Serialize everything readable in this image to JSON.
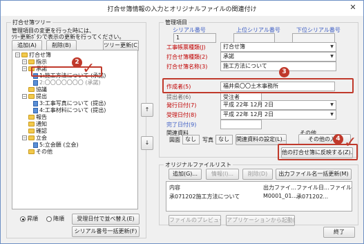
{
  "window": {
    "title": "打合せ簿情報の入力とオリジナルファイルの関連付け",
    "close": "✕"
  },
  "tree_panel": {
    "heading": "打合せ簿ツリー",
    "note_line1": "管理項目の変更を行った時には、",
    "note_line2": "ﾂﾘｰ更新ﾎﾞﾀﾝで表示の更新を行ってください。",
    "add": "追加(A)",
    "delete": "削除(B)",
    "refresh": "ツリー更新(C)",
    "nodes": [
      {
        "text": "打合せ簿",
        "type": "folder",
        "exp": "−"
      },
      {
        "text": "指示",
        "type": "folder",
        "exp": "−"
      },
      {
        "text": "承諾",
        "type": "folder",
        "exp": "−"
      },
      {
        "text": "1:施工方法について (承諾)",
        "type": "doc",
        "exp": ""
      },
      {
        "text": "2:〇〇〇〇〇〇〇 (承諾)",
        "type": "doc",
        "exp": ""
      },
      {
        "text": "協議",
        "type": "folder",
        "exp": ""
      },
      {
        "text": "提出",
        "type": "folder",
        "exp": "−"
      },
      {
        "text": "3:工事写真について (提出)",
        "type": "doc",
        "exp": ""
      },
      {
        "text": "4:工事材料について (提出)",
        "type": "doc",
        "exp": ""
      },
      {
        "text": "報告",
        "type": "folder",
        "exp": ""
      },
      {
        "text": "通知",
        "type": "folder",
        "exp": ""
      },
      {
        "text": "確認",
        "type": "folder",
        "exp": ""
      },
      {
        "text": "立会",
        "type": "folder",
        "exp": "−"
      },
      {
        "text": "5:立会願 (立会)",
        "type": "doc",
        "exp": ""
      },
      {
        "text": "その他",
        "type": "folder",
        "exp": ""
      }
    ],
    "sort_asc": "昇順",
    "sort_desc": "降順",
    "sort_by_date": "受理日付で並べ替え(E)",
    "serial_refresh": "シリアル番号一括更新(F)"
  },
  "callouts": {
    "c2": "2",
    "c3": "3",
    "c4": "4"
  },
  "side_buttons": {
    "up": "↑",
    "down": "↓"
  },
  "mgmt": {
    "heading": "管理項目",
    "col_serial": "シリアル番号",
    "col_upper": "上位シリアル番号",
    "col_lower": "下位シリアル番号",
    "serial_value": "1",
    "rows": [
      {
        "label": "工事帳票種類(J)",
        "value": "打合せ簿",
        "red": true,
        "dropdown": true
      },
      {
        "label": "打合せ簿種類(2)",
        "value": "承諾",
        "red": true,
        "dropdown": true
      },
      {
        "label": "打合せ簿名称(3)",
        "value": "施工方法について",
        "red": true,
        "dropdown": false
      },
      {
        "label": "作成者(5)",
        "value": "福井県〇〇土木事務所",
        "red": true,
        "dropdown": false
      },
      {
        "label": "提出者(6)",
        "value": "受注者",
        "red": false,
        "dropdown": false
      },
      {
        "label": "発行日付(7)",
        "value": "平成 22年 12月  2日",
        "red": true,
        "dropdown": true
      },
      {
        "label": "受理日付(8)",
        "value": "平成 22年 12月  2日",
        "red": true,
        "dropdown": true
      },
      {
        "label": "完了日付(9)",
        "value": "",
        "red": false,
        "dropdown": false
      }
    ],
    "related_label": "関連資料",
    "related_drawing": "図面",
    "related_drawing_value": "なし",
    "related_photo": "写真",
    "related_photo_value": "なし",
    "related_settings": "関連資料の設定(L)...",
    "other_label": "その他",
    "other_input": "その他の入力",
    "reflect": "他の打合せ簿に反映する(Z)..."
  },
  "original": {
    "heading": "オリジナルファイルリスト",
    "add": "追加(G)...",
    "info": "情報(I)...",
    "delete": "削除(D)",
    "rename_all": "出力ファイル名一括更新(M)",
    "headers": [
      "内容",
      "出力ファイ...",
      "ファイル日...",
      "ファイル..."
    ],
    "rows": [
      [
        "承071202施工方法について",
        "M0001_01...",
        "承071202...",
        ""
      ]
    ],
    "preview": "ファイルのプレビュー(K)...",
    "launch": "アプリケーションから起動(O)"
  },
  "footer": {
    "close": "終了"
  },
  "colors": {
    "accent_red": "#c0392b",
    "label_red": "#c00000",
    "label_blue": "#3b5cc4"
  }
}
